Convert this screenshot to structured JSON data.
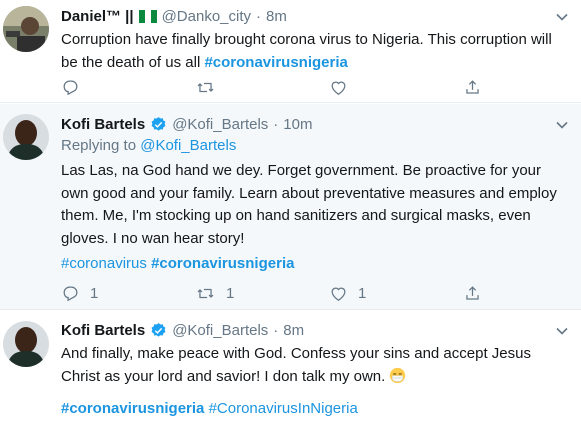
{
  "tweets": [
    {
      "name": "Daniel™ ||",
      "handle": "@Danko_city",
      "dot": "·",
      "time": "8m",
      "text": "Corruption have finally brought corona virus to Nigeria. This corruption will be the death of us all",
      "hashtags": [
        "#coronavirusnigeria"
      ]
    },
    {
      "name": "Kofi Bartels",
      "handle": "@Kofi_Bartels",
      "dot": "·",
      "time": "10m",
      "replying_prefix": "Replying to",
      "replying_handle": "@Kofi_Bartels",
      "text": "Las Las, na God hand we dey. Forget government. Be proactive for your own good and your family. Learn about preventative measures and employ them. Me, I'm stocking up on hand sanitizers and surgical masks, even gloves. I no wan hear story!",
      "hashtags": [
        "#coronavirus",
        "#coronavirusnigeria"
      ],
      "reply_count": "1",
      "retweet_count": "1",
      "like_count": "1"
    },
    {
      "name": "Kofi Bartels",
      "handle": "@Kofi_Bartels",
      "dot": "·",
      "time": "8m",
      "text": "And finally, make peace with God. Confess your sins and accept Jesus Christ as your lord and savior! I don talk my own.",
      "hashtags": [
        "#coronavirusnigeria",
        "#CoronavirusInNigeria"
      ]
    }
  ],
  "colors": {
    "link": "#1b95e0",
    "muted": "#657786",
    "highlight_bg": "#f5f8fa",
    "verified": "#1da1f2"
  },
  "icons": [
    "avatar",
    "nigeria-flag-icon",
    "verified-badge-icon",
    "chevron-down-icon",
    "reply-icon",
    "retweet-icon",
    "like-icon",
    "share-icon",
    "mask-face-emoji-icon"
  ]
}
